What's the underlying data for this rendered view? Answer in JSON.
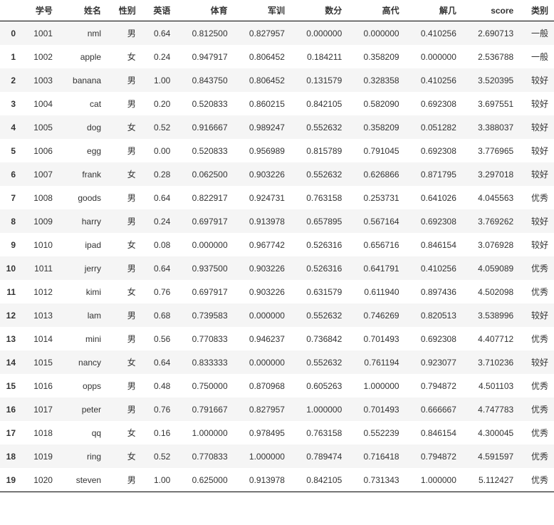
{
  "columns": [
    "",
    "学号",
    "姓名",
    "性别",
    "英语",
    "体育",
    "军训",
    "数分",
    "高代",
    "解几",
    "score",
    "类别"
  ],
  "rows": [
    {
      "idx": "0",
      "学号": "1001",
      "姓名": "nml",
      "性别": "男",
      "英语": "0.64",
      "体育": "0.812500",
      "军训": "0.827957",
      "数分": "0.000000",
      "高代": "0.000000",
      "解几": "0.410256",
      "score": "2.690713",
      "类别": "一般"
    },
    {
      "idx": "1",
      "学号": "1002",
      "姓名": "apple",
      "性别": "女",
      "英语": "0.24",
      "体育": "0.947917",
      "军训": "0.806452",
      "数分": "0.184211",
      "高代": "0.358209",
      "解几": "0.000000",
      "score": "2.536788",
      "类别": "一般"
    },
    {
      "idx": "2",
      "学号": "1003",
      "姓名": "banana",
      "性别": "男",
      "英语": "1.00",
      "体育": "0.843750",
      "军训": "0.806452",
      "数分": "0.131579",
      "高代": "0.328358",
      "解几": "0.410256",
      "score": "3.520395",
      "类别": "较好"
    },
    {
      "idx": "3",
      "学号": "1004",
      "姓名": "cat",
      "性别": "男",
      "英语": "0.20",
      "体育": "0.520833",
      "军训": "0.860215",
      "数分": "0.842105",
      "高代": "0.582090",
      "解几": "0.692308",
      "score": "3.697551",
      "类别": "较好"
    },
    {
      "idx": "4",
      "学号": "1005",
      "姓名": "dog",
      "性别": "女",
      "英语": "0.52",
      "体育": "0.916667",
      "军训": "0.989247",
      "数分": "0.552632",
      "高代": "0.358209",
      "解几": "0.051282",
      "score": "3.388037",
      "类别": "较好"
    },
    {
      "idx": "5",
      "学号": "1006",
      "姓名": "egg",
      "性别": "男",
      "英语": "0.00",
      "体育": "0.520833",
      "军训": "0.956989",
      "数分": "0.815789",
      "高代": "0.791045",
      "解几": "0.692308",
      "score": "3.776965",
      "类别": "较好"
    },
    {
      "idx": "6",
      "学号": "1007",
      "姓名": "frank",
      "性别": "女",
      "英语": "0.28",
      "体育": "0.062500",
      "军训": "0.903226",
      "数分": "0.552632",
      "高代": "0.626866",
      "解几": "0.871795",
      "score": "3.297018",
      "类别": "较好"
    },
    {
      "idx": "7",
      "学号": "1008",
      "姓名": "goods",
      "性别": "男",
      "英语": "0.64",
      "体育": "0.822917",
      "军训": "0.924731",
      "数分": "0.763158",
      "高代": "0.253731",
      "解几": "0.641026",
      "score": "4.045563",
      "类别": "优秀"
    },
    {
      "idx": "8",
      "学号": "1009",
      "姓名": "harry",
      "性别": "男",
      "英语": "0.24",
      "体育": "0.697917",
      "军训": "0.913978",
      "数分": "0.657895",
      "高代": "0.567164",
      "解几": "0.692308",
      "score": "3.769262",
      "类别": "较好"
    },
    {
      "idx": "9",
      "学号": "1010",
      "姓名": "ipad",
      "性别": "女",
      "英语": "0.08",
      "体育": "0.000000",
      "军训": "0.967742",
      "数分": "0.526316",
      "高代": "0.656716",
      "解几": "0.846154",
      "score": "3.076928",
      "类别": "较好"
    },
    {
      "idx": "10",
      "学号": "1011",
      "姓名": "jerry",
      "性别": "男",
      "英语": "0.64",
      "体育": "0.937500",
      "军训": "0.903226",
      "数分": "0.526316",
      "高代": "0.641791",
      "解几": "0.410256",
      "score": "4.059089",
      "类别": "优秀"
    },
    {
      "idx": "11",
      "学号": "1012",
      "姓名": "kimi",
      "性别": "女",
      "英语": "0.76",
      "体育": "0.697917",
      "军训": "0.903226",
      "数分": "0.631579",
      "高代": "0.611940",
      "解几": "0.897436",
      "score": "4.502098",
      "类别": "优秀"
    },
    {
      "idx": "12",
      "学号": "1013",
      "姓名": "lam",
      "性别": "男",
      "英语": "0.68",
      "体育": "0.739583",
      "军训": "0.000000",
      "数分": "0.552632",
      "高代": "0.746269",
      "解几": "0.820513",
      "score": "3.538996",
      "类别": "较好"
    },
    {
      "idx": "13",
      "学号": "1014",
      "姓名": "mini",
      "性别": "男",
      "英语": "0.56",
      "体育": "0.770833",
      "军训": "0.946237",
      "数分": "0.736842",
      "高代": "0.701493",
      "解几": "0.692308",
      "score": "4.407712",
      "类别": "优秀"
    },
    {
      "idx": "14",
      "学号": "1015",
      "姓名": "nancy",
      "性别": "女",
      "英语": "0.64",
      "体育": "0.833333",
      "军训": "0.000000",
      "数分": "0.552632",
      "高代": "0.761194",
      "解几": "0.923077",
      "score": "3.710236",
      "类别": "较好"
    },
    {
      "idx": "15",
      "学号": "1016",
      "姓名": "opps",
      "性别": "男",
      "英语": "0.48",
      "体育": "0.750000",
      "军训": "0.870968",
      "数分": "0.605263",
      "高代": "1.000000",
      "解几": "0.794872",
      "score": "4.501103",
      "类别": "优秀"
    },
    {
      "idx": "16",
      "学号": "1017",
      "姓名": "peter",
      "性别": "男",
      "英语": "0.76",
      "体育": "0.791667",
      "军训": "0.827957",
      "数分": "1.000000",
      "高代": "0.701493",
      "解几": "0.666667",
      "score": "4.747783",
      "类别": "优秀"
    },
    {
      "idx": "17",
      "学号": "1018",
      "姓名": "qq",
      "性别": "女",
      "英语": "0.16",
      "体育": "1.000000",
      "军训": "0.978495",
      "数分": "0.763158",
      "高代": "0.552239",
      "解几": "0.846154",
      "score": "4.300045",
      "类别": "优秀"
    },
    {
      "idx": "18",
      "学号": "1019",
      "姓名": "ring",
      "性别": "女",
      "英语": "0.52",
      "体育": "0.770833",
      "军训": "1.000000",
      "数分": "0.789474",
      "高代": "0.716418",
      "解几": "0.794872",
      "score": "4.591597",
      "类别": "优秀"
    },
    {
      "idx": "19",
      "学号": "1020",
      "姓名": "steven",
      "性别": "男",
      "英语": "1.00",
      "体育": "0.625000",
      "军训": "0.913978",
      "数分": "0.842105",
      "高代": "0.731343",
      "解几": "1.000000",
      "score": "5.112427",
      "类别": "优秀"
    }
  ],
  "watermark": ""
}
